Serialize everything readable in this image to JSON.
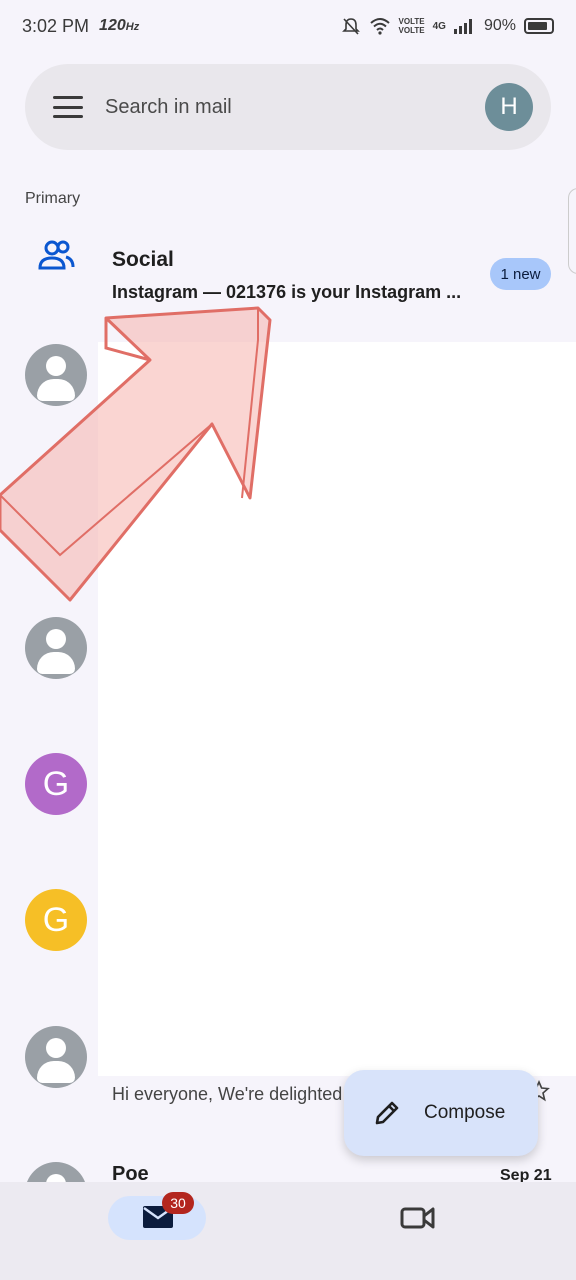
{
  "status_bar": {
    "time": "3:02 PM",
    "refresh": "120",
    "refresh_unit": "Hz",
    "volte1": "VOLTE",
    "volte2": "VOLTE",
    "network": "4G",
    "battery": "90%"
  },
  "search": {
    "placeholder": "Search in mail",
    "account_initial": "H"
  },
  "section_label": "Primary",
  "social": {
    "title": "Social",
    "snippet": "Instagram — 021376 is your Instagram ...",
    "badge": "1 new"
  },
  "avatars": [
    {
      "type": "person",
      "letter": "",
      "color": "#9aa0a6"
    },
    {
      "type": "person",
      "letter": "",
      "color": "#9aa0a6"
    },
    {
      "type": "letter",
      "letter": "G",
      "color": "#b26ac9"
    },
    {
      "type": "letter",
      "letter": "G",
      "color": "#f6bf26"
    },
    {
      "type": "person",
      "letter": "",
      "color": "#9aa0a6"
    },
    {
      "type": "person",
      "letter": "",
      "color": "#9aa0a6"
    }
  ],
  "email_snippet": "Hi everyone, We're delighted",
  "poe": {
    "sender": "Poe",
    "date": "Sep 21"
  },
  "compose": {
    "label": "Compose"
  },
  "bottom_nav": {
    "mail_badge": "30"
  },
  "colors": {
    "accent": "#0b57d0",
    "badge": "#a8c7fa",
    "compose_bg": "#d8e3fa",
    "arrow": "#f5b3ad"
  }
}
